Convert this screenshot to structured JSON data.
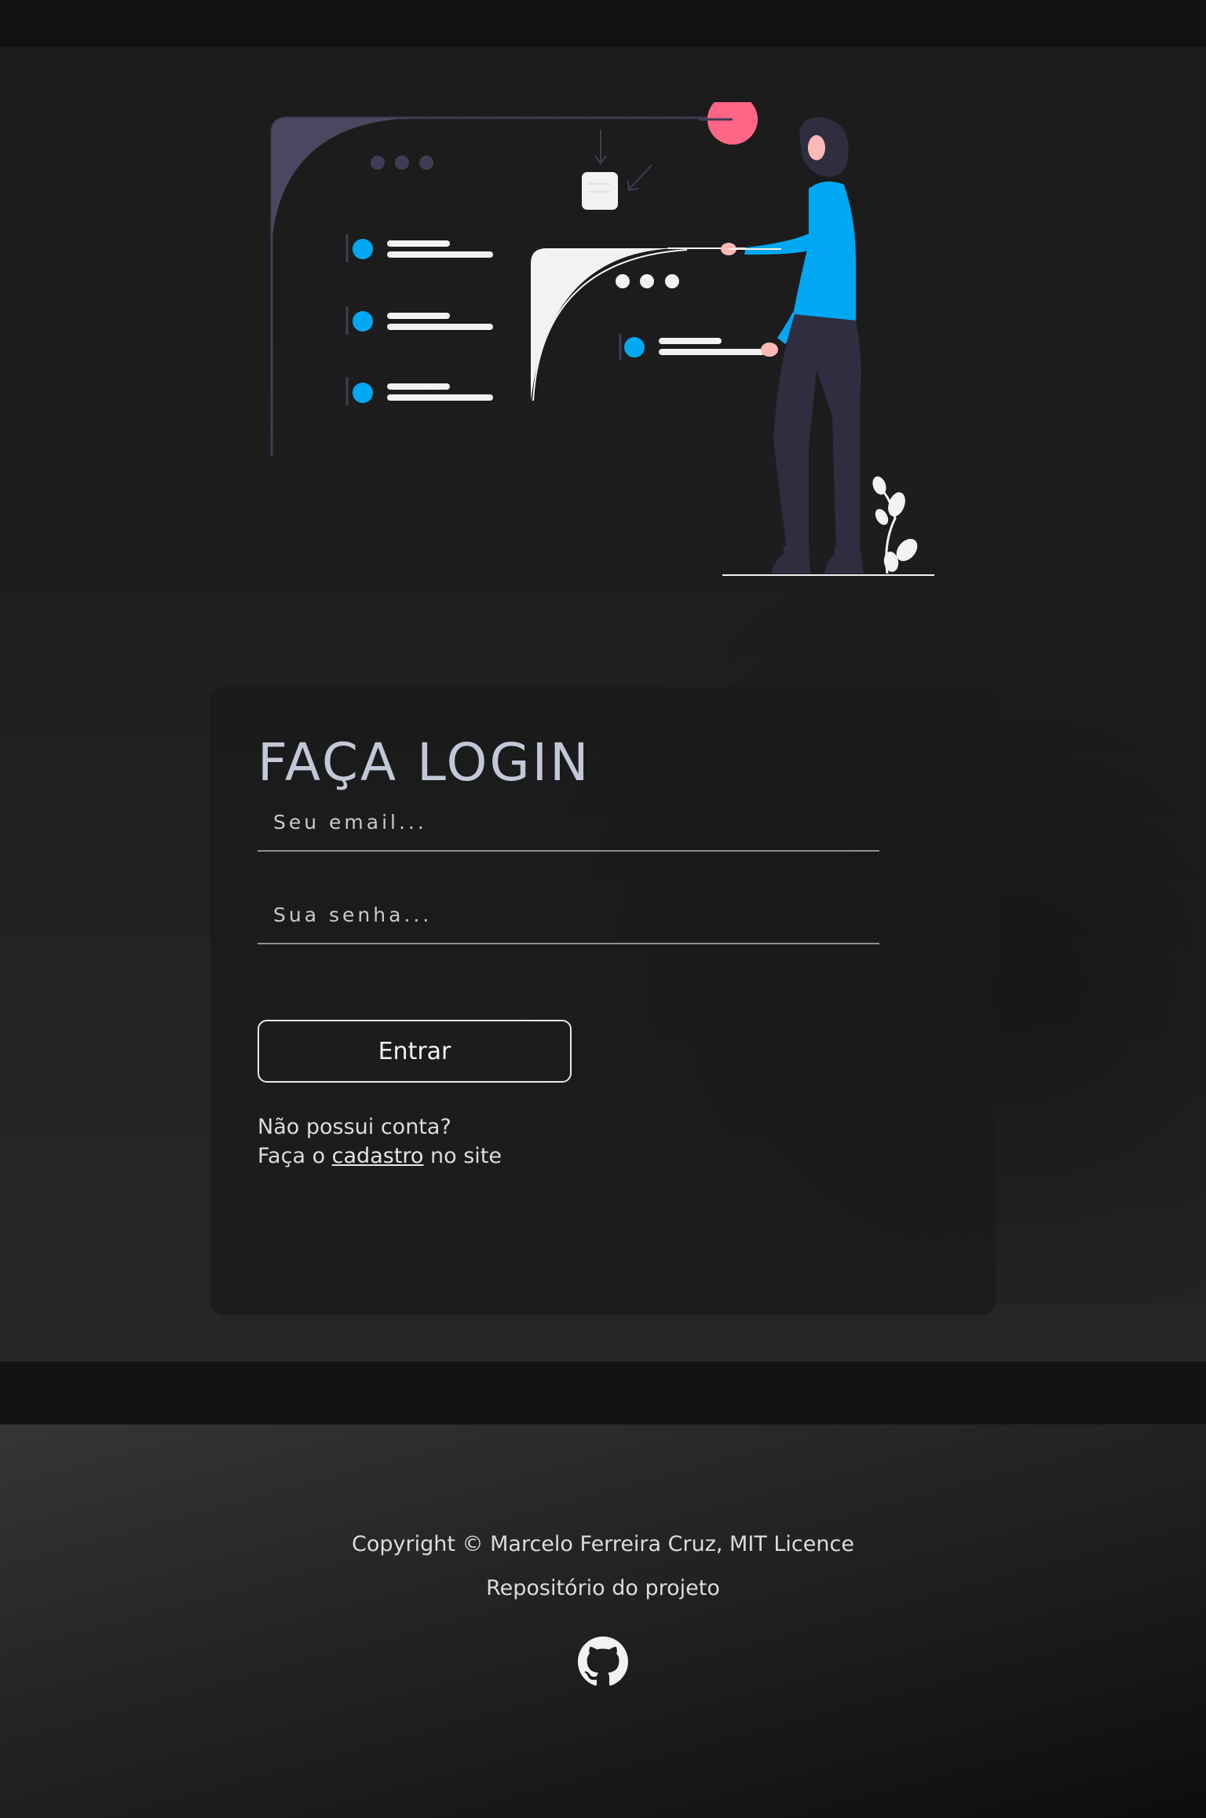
{
  "login": {
    "title": "FAÇA LOGIN",
    "email_placeholder": "Seu email...",
    "password_placeholder": "Sua senha...",
    "submit_label": "Entrar",
    "no_account_text": "Não possui conta?",
    "signup_prefix": "Faça o ",
    "signup_link": "cadastro",
    "signup_suffix": " no site"
  },
  "footer": {
    "copyright": "Copyright © Marcelo Ferreira Cruz, MIT Licence",
    "repo_link": "Repositório do projeto",
    "github_icon": "github-icon"
  },
  "colors": {
    "accent_blue": "#00a8f3",
    "accent_pink": "#ff6584",
    "panel_purple": "#3f3d56",
    "figure_pants": "#2f2e41"
  }
}
